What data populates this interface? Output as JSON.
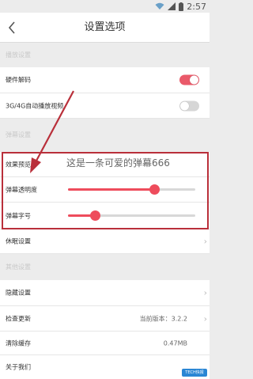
{
  "status_bar": {
    "time": "2:57"
  },
  "header": {
    "title": "设置选项"
  },
  "sections": {
    "playback": {
      "title": "播放设置"
    },
    "danmaku": {
      "title": "弹幕设置"
    },
    "other": {
      "title": "其他设置"
    }
  },
  "playback": {
    "hardware_decode": {
      "label": "硬件解码",
      "enabled": true
    },
    "auto_play_3g4g": {
      "label": "3G/4G自动播放视频",
      "enabled": false
    }
  },
  "danmaku": {
    "preview_label": "效果预览",
    "preview_text": "这是一条可爱的弹幕666",
    "opacity": {
      "label": "弹幕透明度",
      "value": 0.68
    },
    "font_size": {
      "label": "弹幕字号",
      "value": 0.21
    }
  },
  "rows": {
    "timer": {
      "label": "休眠设置"
    },
    "cleanup": {
      "label": "隐藏设置"
    },
    "update": {
      "label": "检查更新",
      "value": "当前版本：3.2.2"
    },
    "cache": {
      "label": "清除缓存",
      "value": "0.47MB"
    },
    "about": {
      "label": "关于我们"
    }
  },
  "watermark": {
    "text": "TECH快报"
  },
  "colors": {
    "accent": "#ea5a6a",
    "slider_accent": "#ee4c5c",
    "annotation": "#b92f3a"
  },
  "icons": [
    "back-arrow-icon",
    "chevron-right-icon",
    "wifi-icon",
    "signal-icon",
    "battery-icon"
  ]
}
